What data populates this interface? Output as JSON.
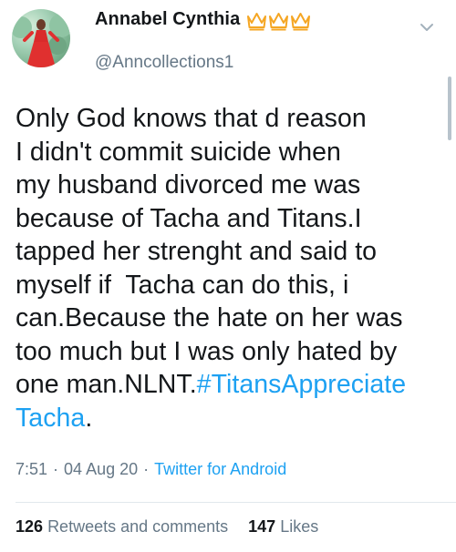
{
  "user": {
    "display_name": "Annabel Cynthia",
    "handle": "@Anncollections1",
    "badge_icons": [
      "crown-icon",
      "crown-icon",
      "crown-icon"
    ],
    "badge_color": "#f5a623"
  },
  "tweet": {
    "text": "Only God knows that d reason\nI didn't commit suicide when\nmy husband divorced me was\nbecause of Tacha and Titans.I\ntapped her strenght and said to\nmyself if  Tacha can do this, i\ncan.Because the hate on her was\ntoo much but I was only hated by\none man.NLNT.",
    "hashtag": "#TitansAppreciate\nTacha",
    "after_hashtag": "."
  },
  "meta": {
    "time": "7:51",
    "separator": "·",
    "date": "04 Aug 20",
    "source": "Twitter for Android"
  },
  "stats": {
    "retweets_count": "126",
    "retweets_label": "Retweets and comments",
    "likes_count": "147",
    "likes_label": "Likes"
  },
  "colors": {
    "link": "#1da1f2",
    "secondary_text": "#657786",
    "primary_text": "#14171a"
  }
}
